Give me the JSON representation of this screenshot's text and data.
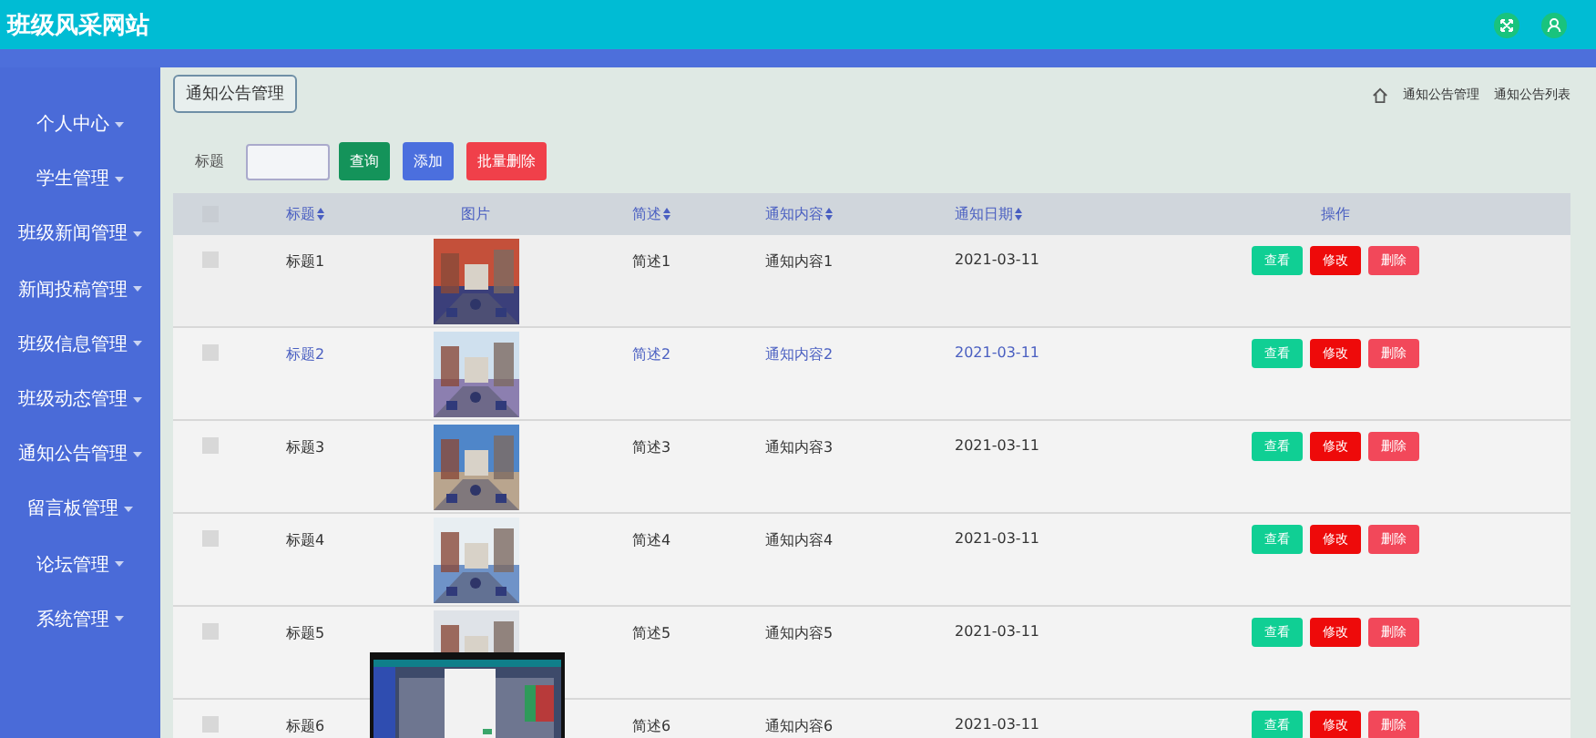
{
  "header": {
    "title": "班级风采网站"
  },
  "sidebar": {
    "items": [
      {
        "label": "个人中心"
      },
      {
        "label": "学生管理"
      },
      {
        "label": "班级新闻管理"
      },
      {
        "label": "新闻投稿管理"
      },
      {
        "label": "班级信息管理"
      },
      {
        "label": "班级动态管理"
      },
      {
        "label": "通知公告管理"
      },
      {
        "label": "留言板管理"
      },
      {
        "label": "论坛管理"
      },
      {
        "label": "系统管理"
      }
    ]
  },
  "page_tag": "通知公告管理",
  "breadcrumb": [
    "通知公告管理",
    "通知公告列表"
  ],
  "search": {
    "label": "标题",
    "buttons": [
      {
        "label": "查询",
        "kind": "search"
      },
      {
        "label": "添加",
        "kind": "add"
      },
      {
        "label": "批量删除",
        "kind": "delete"
      }
    ]
  },
  "table": {
    "select_all_checked": false,
    "columns": [
      {
        "label": "标题",
        "sortable": true
      },
      {
        "label": "图片",
        "sortable": false
      },
      {
        "label": "简述",
        "sortable": true
      },
      {
        "label": "通知内容",
        "sortable": true
      },
      {
        "label": "通知日期",
        "sortable": true
      },
      {
        "label": "操作",
        "sortable": false
      }
    ],
    "rows": [
      {
        "checked": false,
        "hovered": false,
        "title": "标题1",
        "image": {
          "kind": "picture"
        },
        "summary": "简述1",
        "content": "通知内容1",
        "date": "2021-03-11",
        "actions": [
          "查看",
          "修改",
          "删除"
        ]
      },
      {
        "checked": false,
        "hovered": true,
        "title": "标题2",
        "image": {
          "kind": "picture"
        },
        "summary": "简述2",
        "content": "通知内容2",
        "date": "2021-03-11",
        "actions": [
          "查看",
          "修改",
          "删除"
        ]
      },
      {
        "checked": false,
        "hovered": false,
        "title": "标题3",
        "image": {
          "kind": "picture"
        },
        "summary": "简述3",
        "content": "通知内容3",
        "date": "2021-03-11",
        "actions": [
          "查看",
          "修改",
          "删除"
        ]
      },
      {
        "checked": false,
        "hovered": false,
        "title": "标题4",
        "image": {
          "kind": "picture"
        },
        "summary": "简述4",
        "content": "通知内容4",
        "date": "2021-03-11",
        "actions": [
          "查看",
          "修改",
          "删除"
        ]
      },
      {
        "checked": false,
        "hovered": false,
        "title": "标题5",
        "image": {
          "kind": "picture"
        },
        "summary": "简述5",
        "content": "通知内容5",
        "date": "2021-03-11",
        "actions": [
          "查看",
          "修改",
          "删除"
        ]
      },
      {
        "checked": false,
        "hovered": false,
        "title": "标题6",
        "summary": "简述6",
        "content": "通知内容6",
        "date": "2021-03-11",
        "actions": [
          "查看",
          "修改",
          "删除"
        ]
      }
    ]
  },
  "preview": {
    "kind": "picture"
  }
}
